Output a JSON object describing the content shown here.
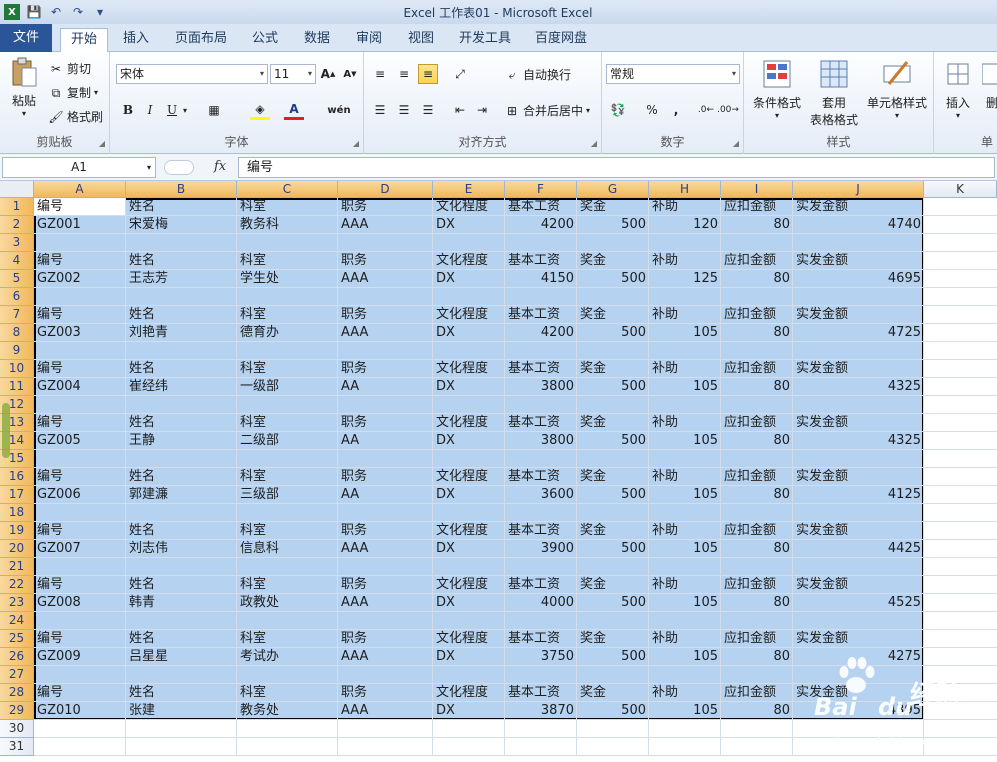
{
  "window": {
    "title": "Excel 工作表01 - Microsoft Excel"
  },
  "ribbon": {
    "tabs": [
      "文件",
      "开始",
      "插入",
      "页面布局",
      "公式",
      "数据",
      "审阅",
      "视图",
      "开发工具",
      "百度网盘"
    ],
    "active_tab": "开始",
    "clipboard": {
      "label": "剪贴板",
      "paste": "粘贴",
      "cut": "剪切",
      "copy": "复制",
      "format_painter": "格式刷"
    },
    "font": {
      "label": "字体",
      "name": "宋体",
      "size": "11",
      "bold": "B",
      "italic": "I",
      "underline": "U",
      "phonetic": "wén"
    },
    "alignment": {
      "label": "对齐方式",
      "wrap_text": "自动换行",
      "merge_center": "合并后居中"
    },
    "number": {
      "label": "数字",
      "format": "常规",
      "percent": "%",
      "comma": ","
    },
    "styles": {
      "label": "样式",
      "conditional": "条件格式",
      "table_line1": "套用",
      "table_line2": "表格格式",
      "cell_styles": "单元格样式"
    },
    "cells": {
      "label": "单",
      "insert": "插入",
      "delete": "删"
    }
  },
  "formula_bar": {
    "name_box": "A1",
    "fx": "fx",
    "content": "编号"
  },
  "grid": {
    "columns": [
      "A",
      "B",
      "C",
      "D",
      "E",
      "F",
      "G",
      "H",
      "I",
      "J",
      "K"
    ],
    "header_row": [
      "编号",
      "姓名",
      "科室",
      "职务",
      "文化程度",
      "基本工资",
      "奖金",
      "补助",
      "应扣金额",
      "实发金额"
    ],
    "records": [
      [
        "GZ001",
        "宋爱梅",
        "教务科",
        "AAA",
        "DX",
        "4200",
        "500",
        "120",
        "80",
        "4740"
      ],
      [
        "GZ002",
        "王志芳",
        "学生处",
        "AAA",
        "DX",
        "4150",
        "500",
        "125",
        "80",
        "4695"
      ],
      [
        "GZ003",
        "刘艳青",
        "德育办",
        "AAA",
        "DX",
        "4200",
        "500",
        "105",
        "80",
        "4725"
      ],
      [
        "GZ004",
        "崔经纬",
        "一级部",
        "AA",
        "DX",
        "3800",
        "500",
        "105",
        "80",
        "4325"
      ],
      [
        "GZ005",
        "王静",
        "二级部",
        "AA",
        "DX",
        "3800",
        "500",
        "105",
        "80",
        "4325"
      ],
      [
        "GZ006",
        "郭建濂",
        "三级部",
        "AA",
        "DX",
        "3600",
        "500",
        "105",
        "80",
        "4125"
      ],
      [
        "GZ007",
        "刘志伟",
        "信息科",
        "AAA",
        "DX",
        "3900",
        "500",
        "105",
        "80",
        "4425"
      ],
      [
        "GZ008",
        "韩青",
        "政教处",
        "AAA",
        "DX",
        "4000",
        "500",
        "105",
        "80",
        "4525"
      ],
      [
        "GZ009",
        "吕星星",
        "考试办",
        "AAA",
        "DX",
        "3750",
        "500",
        "105",
        "80",
        "4275"
      ],
      [
        "GZ010",
        "张建",
        "教务处",
        "AAA",
        "DX",
        "3870",
        "500",
        "105",
        "80",
        "4395"
      ]
    ],
    "row_numbers": [
      "1",
      "2",
      "3",
      "4",
      "5",
      "6",
      "7",
      "8",
      "9",
      "10",
      "11",
      "12",
      "13",
      "14",
      "15",
      "16",
      "17",
      "18",
      "19",
      "20",
      "21",
      "22",
      "23",
      "24",
      "25",
      "26",
      "27",
      "28",
      "29",
      "30",
      "31"
    ]
  },
  "watermark": {
    "brand": "Bai",
    "brand2": "du",
    "suffix": "经验",
    "url": "jingyan.baidu.com"
  }
}
